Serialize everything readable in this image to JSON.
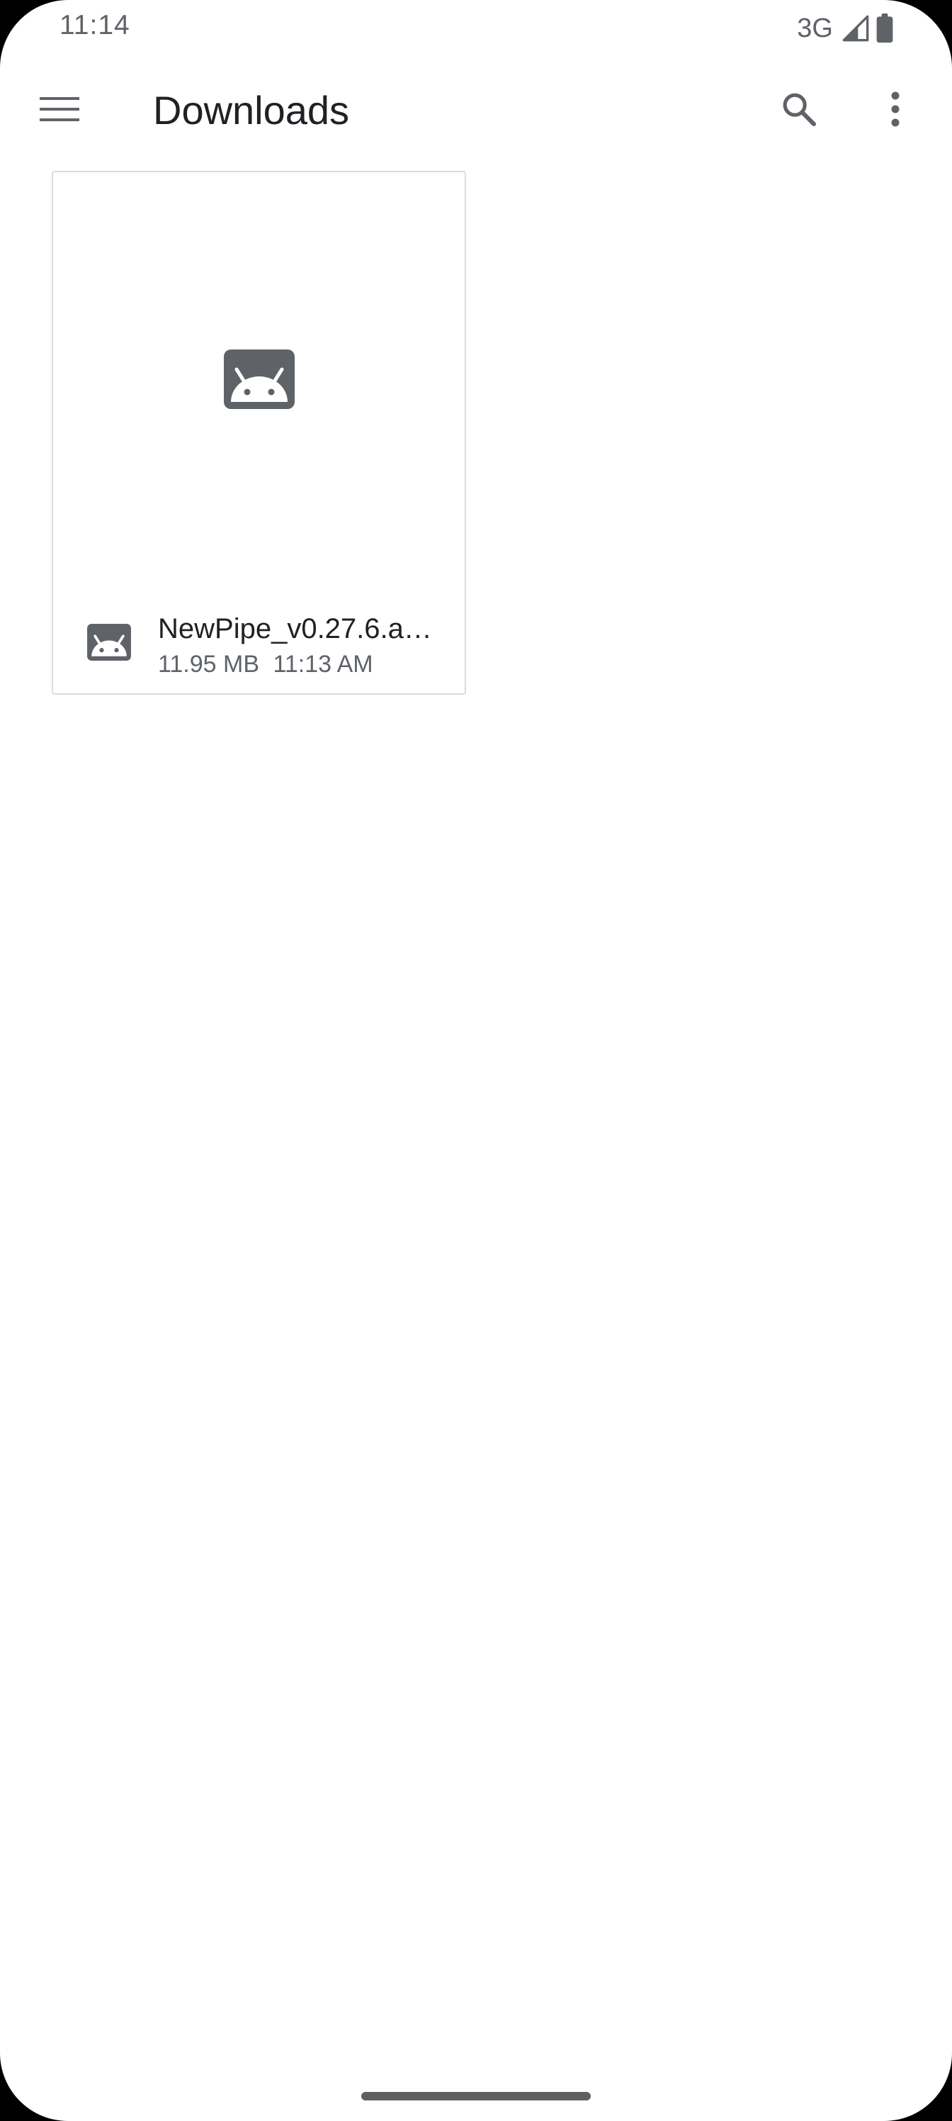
{
  "status_bar": {
    "time": "11:14",
    "network": "3G",
    "icons": [
      "signal-icon",
      "battery-icon"
    ]
  },
  "app_bar": {
    "title": "Downloads",
    "icons": [
      "menu-icon",
      "search-icon",
      "more-vert-icon"
    ]
  },
  "files": [
    {
      "name": "NewPipe_v0.27.6.a…",
      "size": "11.95 MB",
      "time": "11:13 AM",
      "icon": "android-app-icon"
    }
  ],
  "colors": {
    "icon_gray": "#5f6368",
    "text_primary": "#202124",
    "text_secondary": "#5f6368",
    "card_border": "#dadce0",
    "background": "#ffffff"
  }
}
